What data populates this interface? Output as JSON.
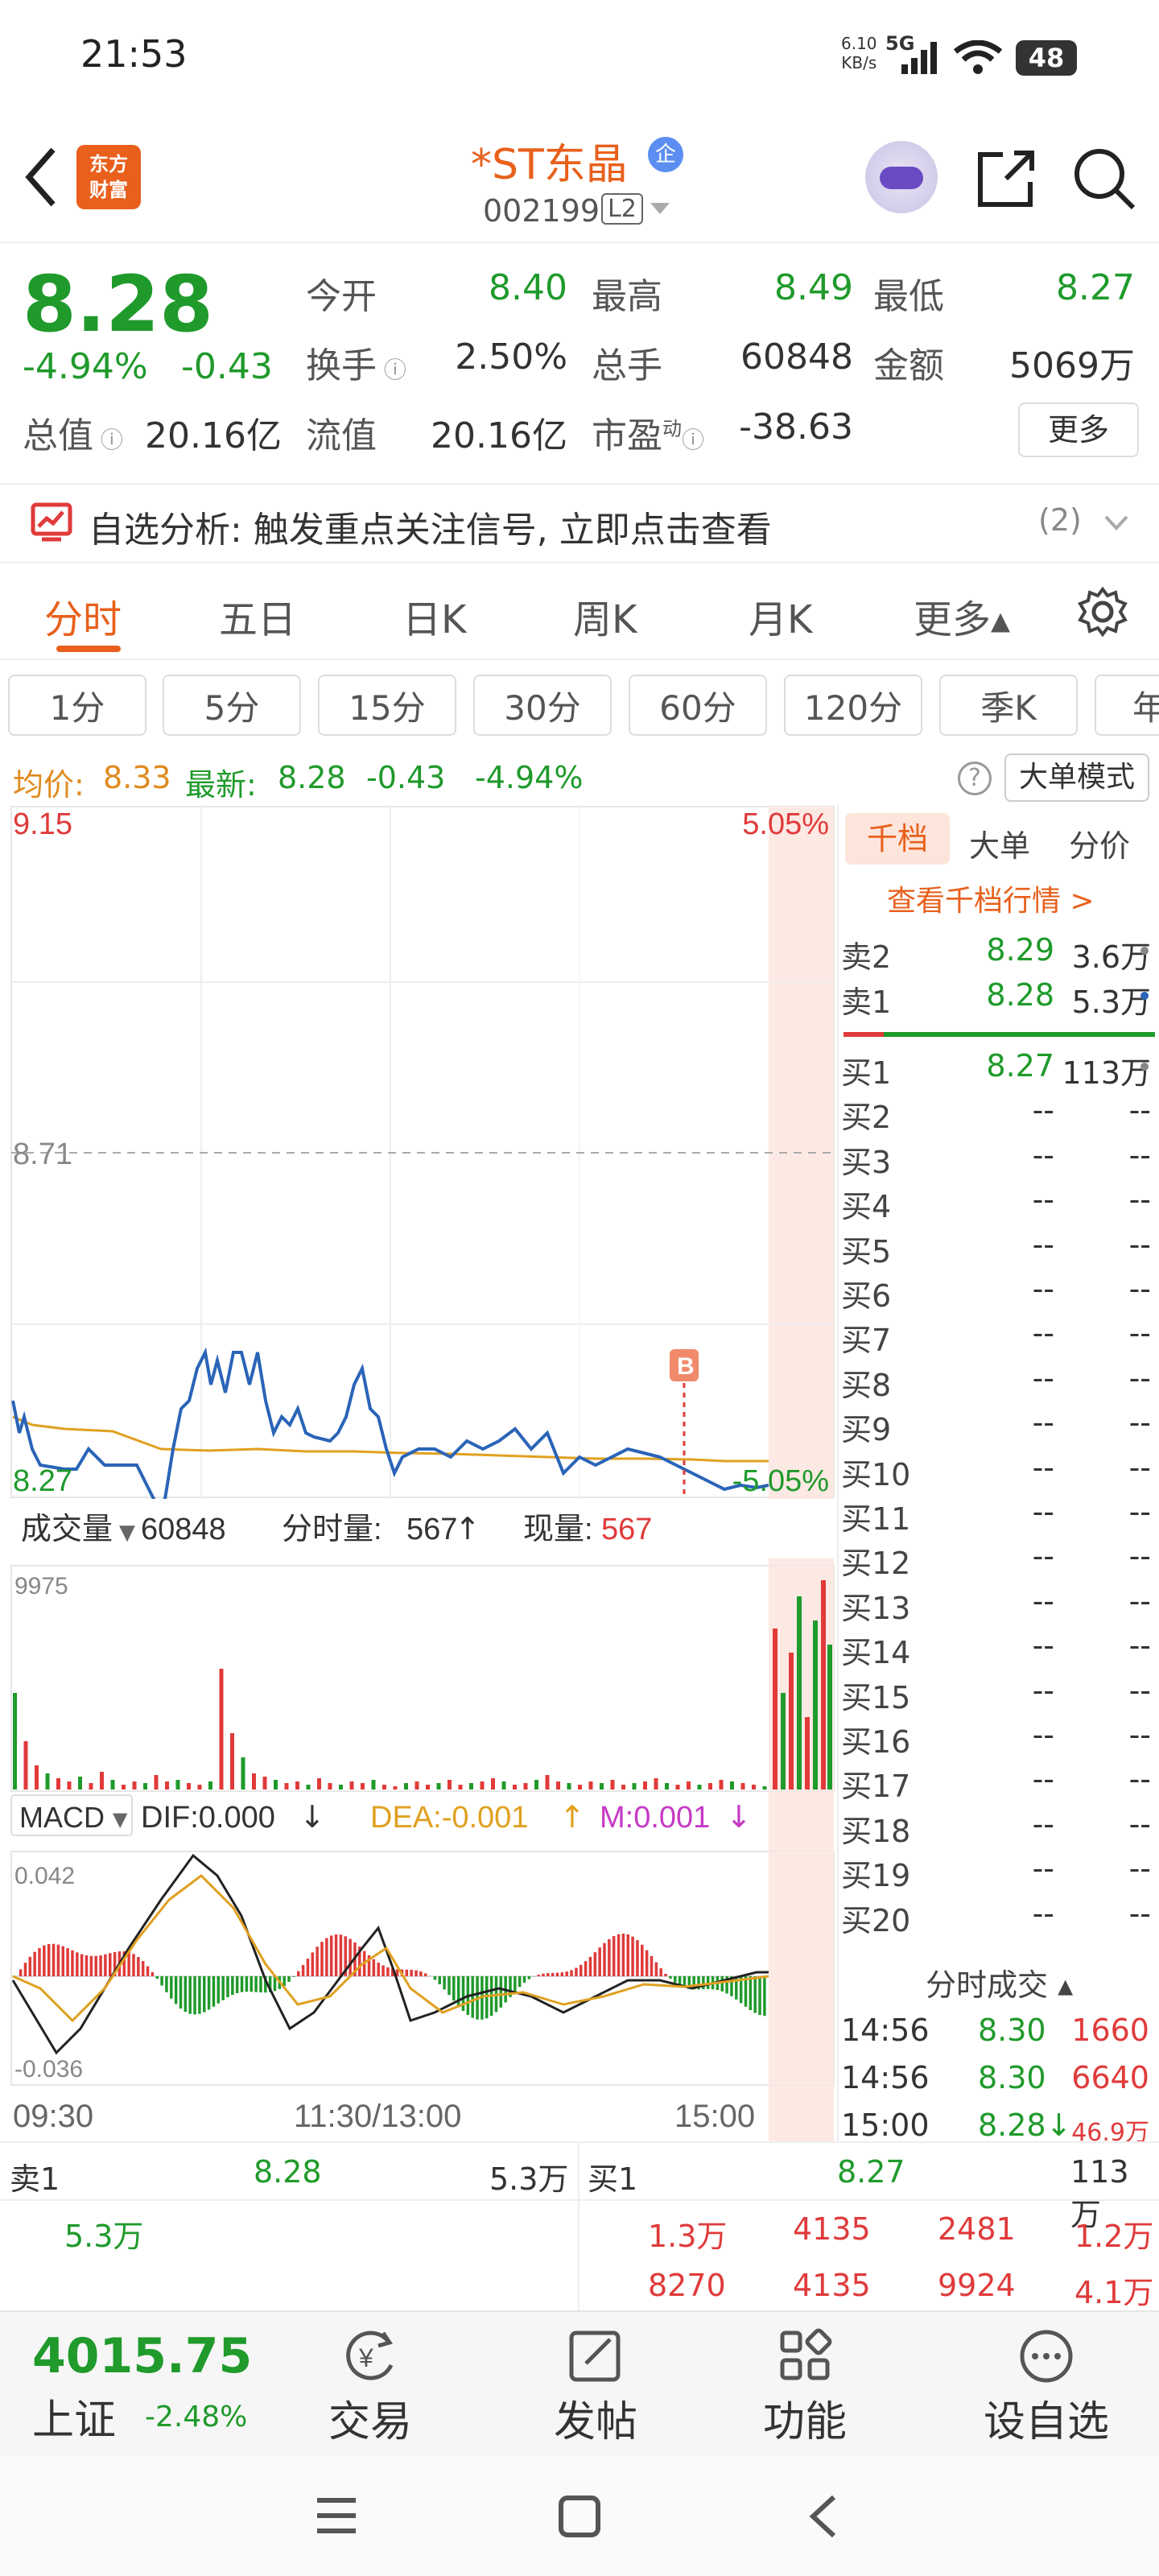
{
  "status": {
    "time": "21:53",
    "net_speed": "6.10",
    "net_unit": "KB/s",
    "network": "5G",
    "battery": "48"
  },
  "header": {
    "title": "*ST东晶",
    "badge": "企",
    "code": "002199",
    "level": "L2",
    "logo_line1": "东方",
    "logo_line2": "财富"
  },
  "quote": {
    "price": "8.28",
    "change_pct": "-4.94%",
    "change": "-0.43",
    "open_label": "今开",
    "open": "8.40",
    "high_label": "最高",
    "high": "8.49",
    "low_label": "最低",
    "low": "8.27",
    "turnover_label": "换手",
    "turnover": "2.50%",
    "volume_label": "总手",
    "volume": "60848",
    "amount_label": "金额",
    "amount": "5069万",
    "mktcap_label": "总值",
    "mktcap": "20.16亿",
    "float_label": "流值",
    "float_cap": "20.16亿",
    "pe_label": "市盈",
    "pe_sup": "动",
    "pe": "-38.63",
    "more": "更多"
  },
  "banner": {
    "text": "自选分析: 触发重点关注信号, 立即点击查看",
    "count": "(2)"
  },
  "tabs": [
    "分时",
    "五日",
    "日K",
    "周K",
    "月K",
    "更多▴"
  ],
  "periods": [
    "1分",
    "5分",
    "15分",
    "30分",
    "60分",
    "120分",
    "季K",
    "年"
  ],
  "info": {
    "avg_label": "均价:",
    "avg": "8.33",
    "latest_label": "最新:",
    "latest": "8.28",
    "chg": "-0.43",
    "pct": "-4.94%",
    "big_order_mode": "大单模式"
  },
  "chart_main": {
    "top_price": "9.15",
    "top_pct": "5.05%",
    "mid_price": "8.71",
    "low_price": "8.27",
    "low_pct": "-5.05%",
    "marker": "B"
  },
  "volume": {
    "label": "成交量",
    "total": "60848",
    "tick_label": "分时量:",
    "tick": "567",
    "arrow": "↑",
    "cur_label": "现量:",
    "cur": "567",
    "max": "9975"
  },
  "macd": {
    "label": "MACD",
    "dif": "DIF:0.000",
    "dif_arrow": "↓",
    "dea": "DEA:-0.001",
    "dea_arrow": "↑",
    "m": "M:0.001",
    "m_arrow": "↓",
    "top": "0.042",
    "bottom": "-0.036"
  },
  "time_axis": [
    "09:30",
    "11:30/13:00",
    "15:00"
  ],
  "side": {
    "tabs": [
      "千档",
      "大单",
      "分价"
    ],
    "link": "查看千档行情 >",
    "sells": [
      {
        "l": "卖2",
        "p": "8.29",
        "v": "3.6万"
      },
      {
        "l": "卖1",
        "p": "8.28",
        "v": "5.3万"
      }
    ],
    "buys": [
      {
        "l": "买1",
        "p": "8.27",
        "v": "113万"
      },
      {
        "l": "买2",
        "p": "--",
        "v": "--"
      },
      {
        "l": "买3",
        "p": "--",
        "v": "--"
      },
      {
        "l": "买4",
        "p": "--",
        "v": "--"
      },
      {
        "l": "买5",
        "p": "--",
        "v": "--"
      },
      {
        "l": "买6",
        "p": "--",
        "v": "--"
      },
      {
        "l": "买7",
        "p": "--",
        "v": "--"
      },
      {
        "l": "买8",
        "p": "--",
        "v": "--"
      },
      {
        "l": "买9",
        "p": "--",
        "v": "--"
      },
      {
        "l": "买10",
        "p": "--",
        "v": "--"
      },
      {
        "l": "买11",
        "p": "--",
        "v": "--"
      },
      {
        "l": "买12",
        "p": "--",
        "v": "--"
      },
      {
        "l": "买13",
        "p": "--",
        "v": "--"
      },
      {
        "l": "买14",
        "p": "--",
        "v": "--"
      },
      {
        "l": "买15",
        "p": "--",
        "v": "--"
      },
      {
        "l": "买16",
        "p": "--",
        "v": "--"
      },
      {
        "l": "买17",
        "p": "--",
        "v": "--"
      },
      {
        "l": "买18",
        "p": "--",
        "v": "--"
      },
      {
        "l": "买19",
        "p": "--",
        "v": "--"
      },
      {
        "l": "买20",
        "p": "--",
        "v": "--"
      }
    ],
    "trades_title": "分时成交 ▴",
    "trades": [
      {
        "t": "14:56",
        "p": "8.30",
        "v": "1660"
      },
      {
        "t": "14:56",
        "p": "8.30",
        "v": "6640"
      },
      {
        "t": "15:00",
        "p": "8.28↓",
        "v": "46.9万"
      }
    ]
  },
  "bottom": {
    "sell_label": "卖1",
    "sell_price": "8.28",
    "sell_vol": "5.3万",
    "sell_q": "5.3万",
    "buy_label": "买1",
    "buy_price": "8.27",
    "buy_vol": "113万",
    "buy_q_row1": [
      "1.3万",
      "4135",
      "2481",
      "1.2万"
    ],
    "buy_q_row2": [
      "8270",
      "4135",
      "9924",
      "4.1万"
    ]
  },
  "nav": {
    "index_value": "4015.75",
    "index_name": "上证",
    "index_pct": "-2.48%",
    "items": [
      "交易",
      "发帖",
      "功能",
      "设自选"
    ]
  },
  "colors": {
    "up": "#e03a3a",
    "down": "#1f9a2b",
    "accent": "#e8601c",
    "avg": "#e0a020",
    "line": "#2a64b8"
  }
}
